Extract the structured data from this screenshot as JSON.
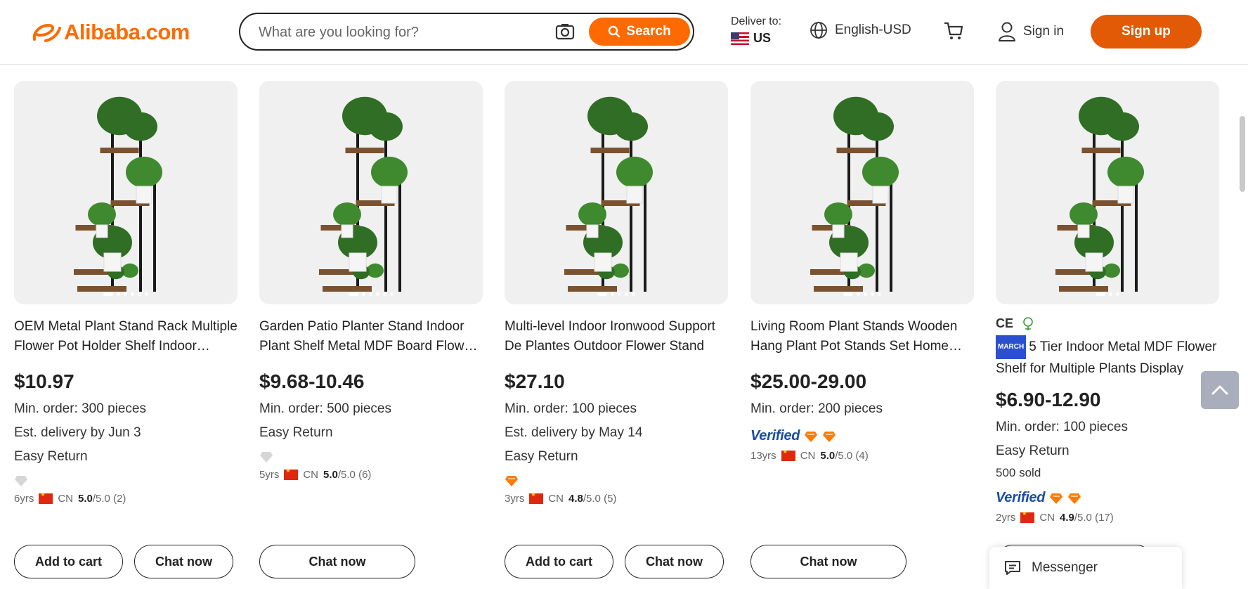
{
  "header": {
    "logo_text": "Alibaba.com",
    "search_placeholder": "What are you looking for?",
    "search_button": "Search",
    "deliver_label": "Deliver to:",
    "deliver_country": "US",
    "language": "English-USD",
    "sign_in": "Sign in",
    "sign_up": "Sign up"
  },
  "products": [
    {
      "title": "OEM Metal Plant Stand Rack Multiple Flower Pot Holder Shelf Indoor Outdoor",
      "price": "$10.97",
      "min_order": "Min. order: 300 pieces",
      "delivery": "Est. delivery by Jun 3",
      "easy_return": "Easy Return",
      "years": "6yrs",
      "country": "CN",
      "rating": "5.0",
      "rating_max": "/5.0",
      "reviews": "(2)",
      "buttons": [
        "Add to cart",
        "Chat now"
      ]
    },
    {
      "title": "Garden Patio Planter Stand Indoor Plant Shelf Metal MDF Board Flower Rack",
      "price": "$9.68-10.46",
      "min_order": "Min. order: 500 pieces",
      "easy_return": "Easy Return",
      "years": "5yrs",
      "country": "CN",
      "rating": "5.0",
      "rating_max": "/5.0",
      "reviews": "(6)",
      "buttons": [
        "Chat now"
      ]
    },
    {
      "title": "Multi-level Indoor Ironwood Support De Plantes Outdoor Flower Stand",
      "price": "$27.10",
      "min_order": "Min. order: 100 pieces",
      "delivery": "Est. delivery by May 14",
      "easy_return": "Easy Return",
      "years": "3yrs",
      "country": "CN",
      "rating": "4.8",
      "rating_max": "/5.0",
      "reviews": "(5)",
      "buttons": [
        "Add to cart",
        "Chat now"
      ]
    },
    {
      "title": "Living Room Plant Stands Wooden Hang Plant Pot Stands Set Home Decor",
      "price": "$25.00-29.00",
      "min_order": "Min. order: 200 pieces",
      "verified": "Verified",
      "years": "13yrs",
      "country": "CN",
      "rating": "5.0",
      "rating_max": "/5.0",
      "reviews": "(4)",
      "buttons": [
        "Chat now"
      ]
    },
    {
      "cert_ce": "CE",
      "march_badge": "MARCH",
      "title": "5 Tier Indoor Metal MDF Flower Shelf for Multiple Plants Display",
      "price": "$6.90-12.90",
      "min_order": "Min. order: 100 pieces",
      "easy_return": "Easy Return",
      "sold": "500 sold",
      "verified": "Verified",
      "years": "2yrs",
      "country": "CN",
      "rating": "4.9",
      "rating_max": "/5.0",
      "reviews": "(17)"
    }
  ],
  "messenger": "Messenger",
  "icons": {
    "search": "search-icon",
    "camera": "camera-icon",
    "globe": "globe-icon",
    "cart": "cart-icon",
    "user": "user-icon",
    "diamond": "diamond-icon",
    "messenger": "message-icon",
    "back_to_top": "chevron-up-icon"
  },
  "colors": {
    "brand": "#ff6a00",
    "signup": "#e25a06",
    "verified": "#1a4ea1",
    "diamond_gold": "#ff7a00",
    "diamond_gray": "#cccccc"
  }
}
